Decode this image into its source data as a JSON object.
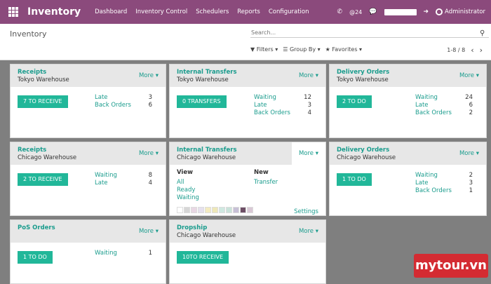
{
  "navbar": {
    "app_title": "Inventory",
    "menu": [
      "Dashboard",
      "Inventory Control",
      "Schedulers",
      "Reports",
      "Configuration"
    ],
    "mentions": "@24",
    "user": "Administrator"
  },
  "control": {
    "breadcrumb": "Inventory",
    "search_placeholder": "Search...",
    "filters": "Filters",
    "group_by": "Group By",
    "favorites": "Favorites",
    "pager": "1-8 / 8"
  },
  "cards": [
    {
      "title": "Receipts",
      "subtitle": "Tokyo Warehouse",
      "more": "More",
      "button": "7 TO RECEIVE",
      "stats": [
        {
          "label": "Late",
          "value": "3"
        },
        {
          "label": "Back Orders",
          "value": "6"
        }
      ]
    },
    {
      "title": "Internal Transfers",
      "subtitle": "Tokyo Warehouse",
      "more": "More",
      "button": "0 TRANSFERS",
      "stats": [
        {
          "label": "Waiting",
          "value": "12"
        },
        {
          "label": "Late",
          "value": "3"
        },
        {
          "label": "Back Orders",
          "value": "4"
        }
      ]
    },
    {
      "title": "Delivery Orders",
      "subtitle": "Tokyo Warehouse",
      "more": "More",
      "button": "2 TO DO",
      "stats": [
        {
          "label": "Waiting",
          "value": "24"
        },
        {
          "label": "Late",
          "value": "6"
        },
        {
          "label": "Back Orders",
          "value": "2"
        }
      ]
    },
    {
      "title": "Receipts",
      "subtitle": "Chicago Warehouse",
      "more": "More",
      "button": "2 TO RECEIVE",
      "stats": [
        {
          "label": "Waiting",
          "value": "8"
        },
        {
          "label": "Late",
          "value": "4"
        }
      ]
    },
    {
      "title": "Internal Transfers",
      "subtitle": "Chicago Warehouse",
      "more": "More",
      "view_heading": "View",
      "view_links": [
        "All",
        "Ready",
        "Waiting"
      ],
      "new_heading": "New",
      "new_links": [
        "Transfer"
      ],
      "settings": "Settings",
      "swatches": [
        "#ffffff",
        "#d6d6d6",
        "#e8d7e4",
        "#e6e0ee",
        "#f4ebc0",
        "#eee7b8",
        "#cfe8e1",
        "#c9e3da",
        "#c7c0d6",
        "#6e4f66",
        "#d9c8d5"
      ]
    },
    {
      "title": "Delivery Orders",
      "subtitle": "Chicago Warehouse",
      "more": "More",
      "button": "1 TO DO",
      "stats": [
        {
          "label": "Waiting",
          "value": "2"
        },
        {
          "label": "Late",
          "value": "3"
        },
        {
          "label": "Back Orders",
          "value": "1"
        }
      ]
    },
    {
      "title": "PoS Orders",
      "subtitle": "",
      "more": "More",
      "button": "1 TO DO",
      "stats": [
        {
          "label": "Waiting",
          "value": "1"
        }
      ]
    },
    {
      "title": "Dropship",
      "subtitle": "Chicago Warehouse",
      "more": "More",
      "button": "10TO RECEIVE",
      "stats": []
    }
  ],
  "watermark": "mytour.vn"
}
